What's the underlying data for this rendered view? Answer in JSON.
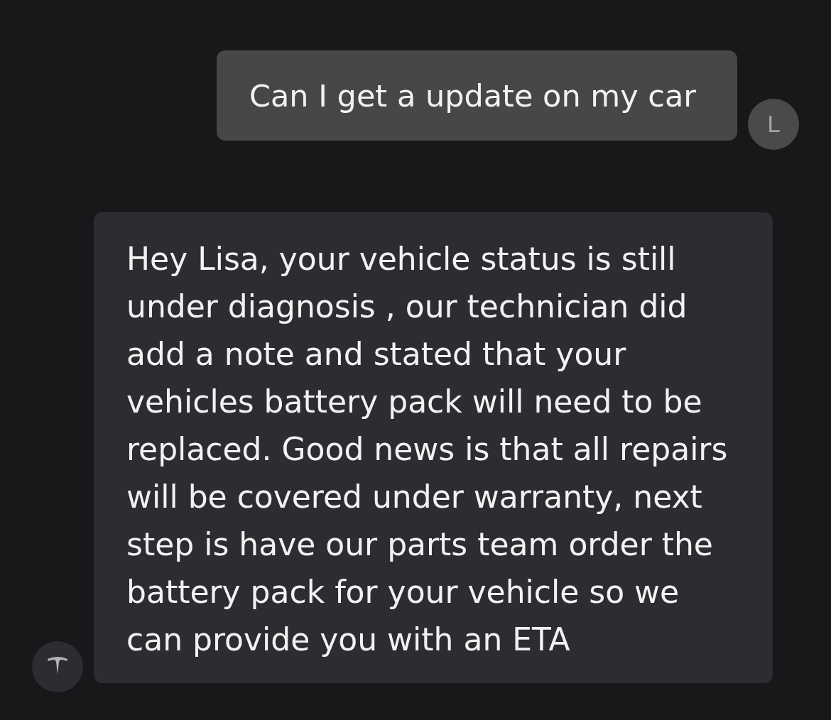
{
  "messages": [
    {
      "kind": "outgoing",
      "text": "Can I get a update on my car",
      "avatar": {
        "initial": "L"
      }
    },
    {
      "kind": "incoming",
      "text": "Hey Lisa, your vehicle status is still under diagnosis , our technician did add a note and stated that your vehicles battery pack will need to be replaced. Good news is that all repairs will be covered under warranty, next step is have our parts team order the battery pack for your vehicle so we can provide you with an ETA"
    }
  ]
}
